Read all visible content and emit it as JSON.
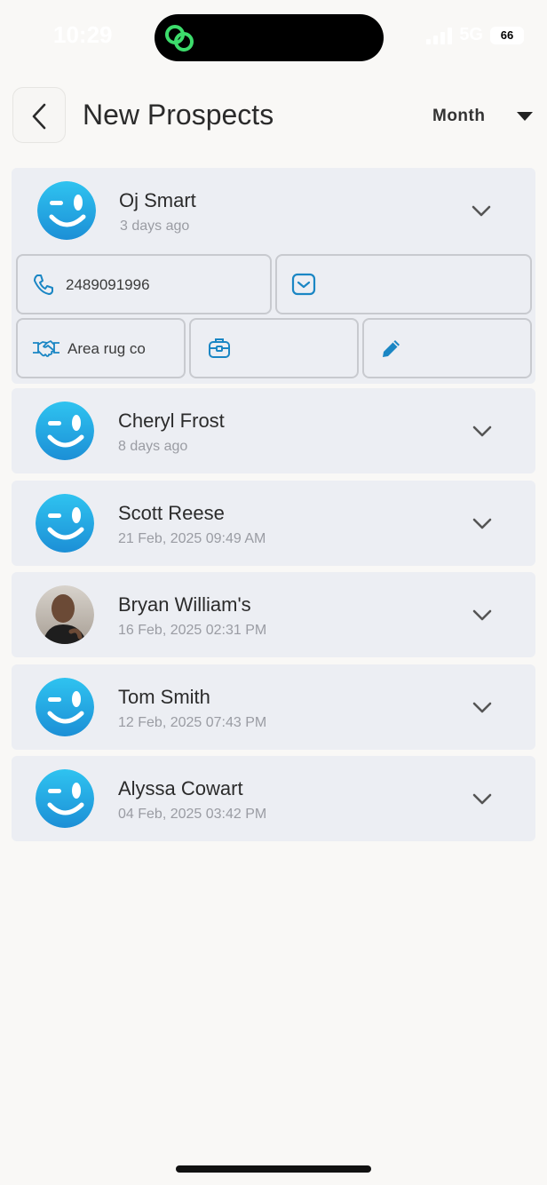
{
  "status_bar": {
    "time": "10:29",
    "network": "5G",
    "battery": "66"
  },
  "header": {
    "title": "New Prospects",
    "period": "Month"
  },
  "prospects": [
    {
      "name": "Oj Smart",
      "time": "3 days ago",
      "avatar": "smiley-logo"
    },
    {
      "name": "Cheryl Frost",
      "time": "8 days ago",
      "avatar": "smiley-logo"
    },
    {
      "name": "Scott Reese",
      "time": "21 Feb, 2025 09:49 AM",
      "avatar": "smiley-logo"
    },
    {
      "name": "Bryan William's",
      "time": "16 Feb, 2025 02:31 PM",
      "avatar": "photo"
    },
    {
      "name": "Tom Smith",
      "time": "12 Feb, 2025 07:43 PM",
      "avatar": "smiley-logo"
    },
    {
      "name": "Alyssa Cowart",
      "time": "04 Feb, 2025 03:42 PM",
      "avatar": "smiley-logo"
    }
  ],
  "expanded_details": {
    "phone": "2489091996",
    "email": "",
    "company": "Area rug co",
    "job": ""
  },
  "colors": {
    "accent": "#1a86c4",
    "avatar_gradient_top": "#2fc3f0",
    "avatar_gradient_bottom": "#1c8fd6",
    "card_bg": "#eceef3"
  },
  "icons": [
    "back-arrow-icon",
    "caret-down-icon",
    "chevron-down-icon",
    "phone-icon",
    "email-icon",
    "handshake-icon",
    "briefcase-icon",
    "pencil-icon"
  ]
}
